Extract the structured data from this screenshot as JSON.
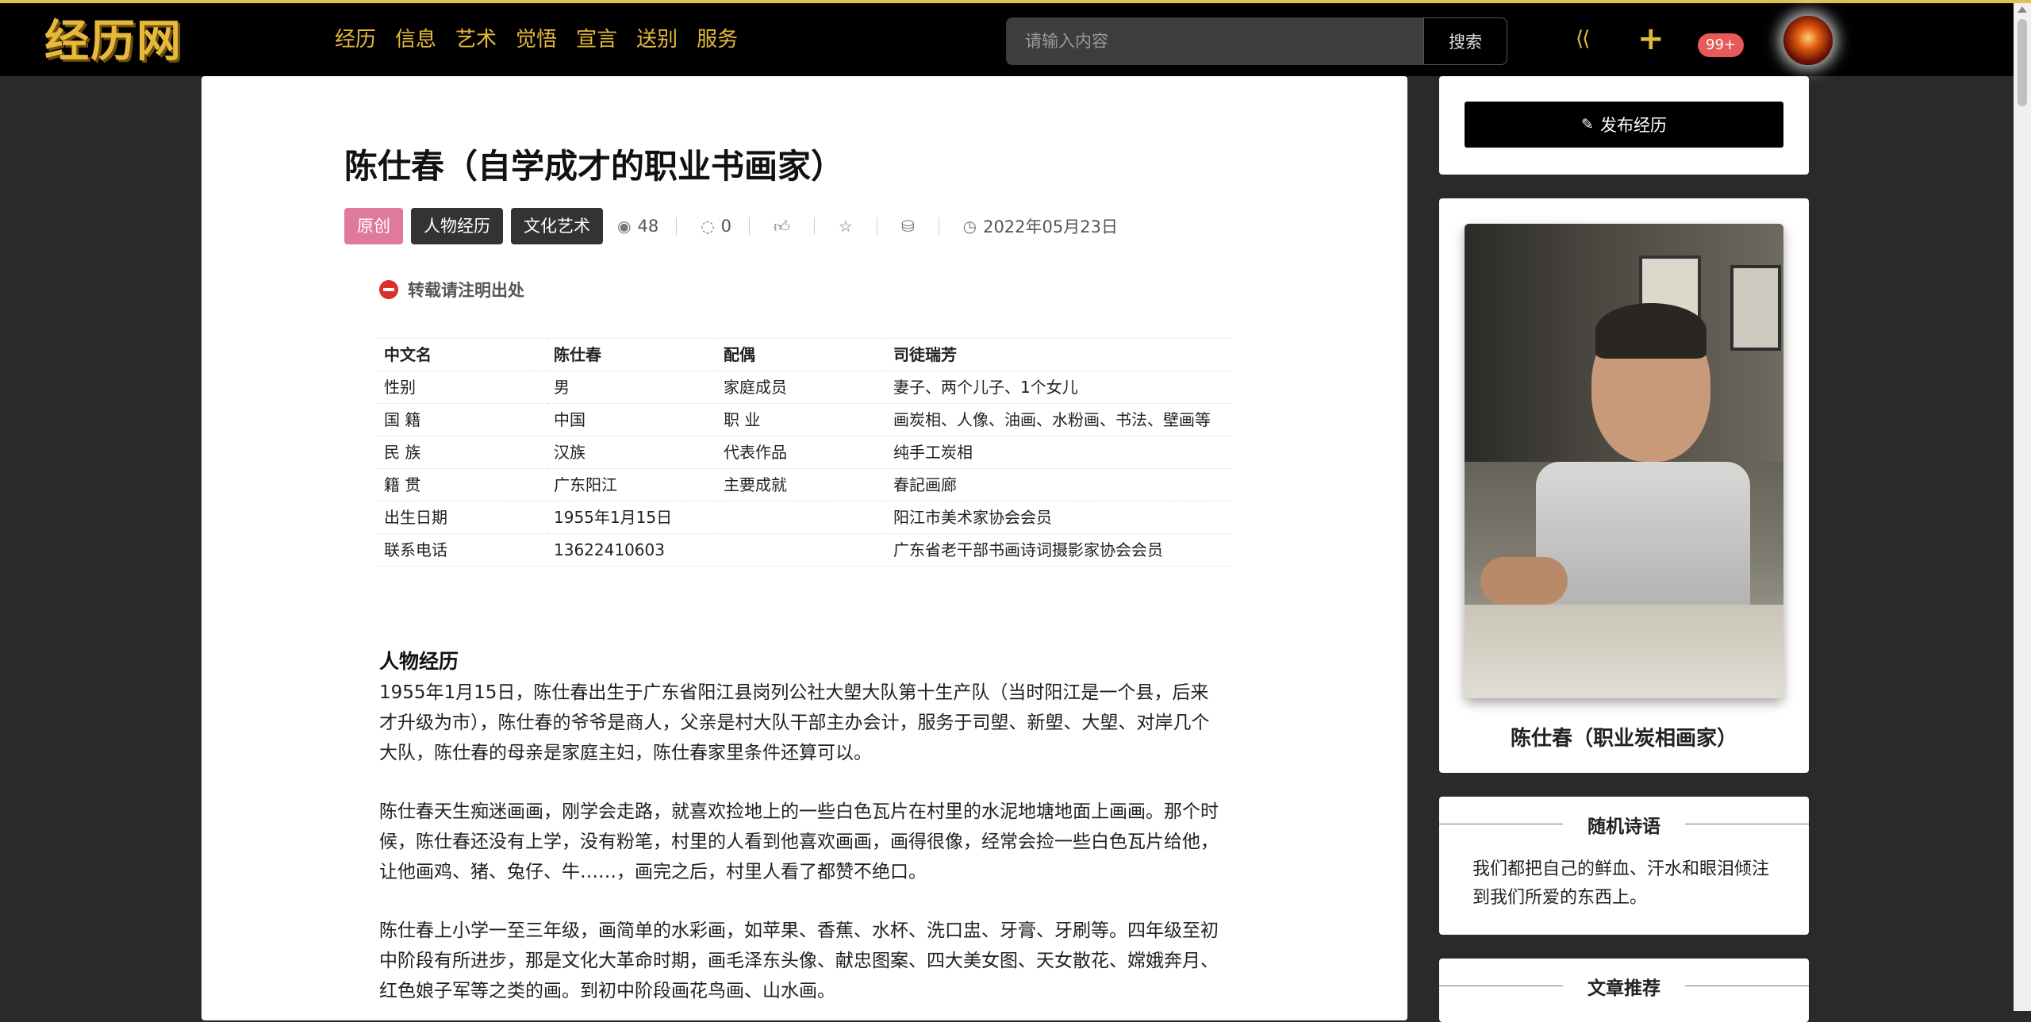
{
  "header": {
    "logo": "经历网",
    "nav": [
      "经历",
      "信息",
      "艺术",
      "觉悟",
      "宣言",
      "送别",
      "服务"
    ],
    "search_placeholder": "请输入内容",
    "search_button": "搜索",
    "notification_count": "99+"
  },
  "article": {
    "title": "陈仕春（自学成才的职业书画家）",
    "tags": [
      "原创",
      "人物经历",
      "文化艺术"
    ],
    "views": "48",
    "comments": "0",
    "date": "2022年05月23日",
    "notice": "转载请注明出处",
    "info_rows": [
      [
        "中文名",
        "陈仕春",
        "配偶",
        "司徒瑞芳"
      ],
      [
        "性别",
        "男",
        "家庭成员",
        "妻子、两个儿子、1个女儿"
      ],
      [
        "国 籍",
        "中国",
        "职 业",
        "画炭相、人像、油画、水粉画、书法、壁画等"
      ],
      [
        "民 族",
        "汉族",
        "代表作品",
        "纯手工炭相"
      ],
      [
        "籍 贯",
        "广东阳江",
        "主要成就",
        "春記画廊"
      ],
      [
        "出生日期",
        "1955年1月15日",
        "",
        "阳江市美术家协会会员"
      ],
      [
        "联系电话",
        "13622410603",
        "",
        "广东省老干部书画诗词摄影家协会会员"
      ]
    ],
    "section_title": "人物经历",
    "paragraphs": [
      "1955年1月15日，陈仕春出生于广东省阳江县岗列公社大塱大队第十生产队（当时阳江是一个县，后来才升级为市），陈仕春的爷爷是商人，父亲是村大队干部主办会计，服务于司塱、新塱、大塱、对岸几个大队，陈仕春的母亲是家庭主妇，陈仕春家里条件还算可以。",
      "陈仕春天生痴迷画画，刚学会走路，就喜欢捡地上的一些白色瓦片在村里的水泥地塘地面上画画。那个时候，陈仕春还没有上学，没有粉笔，村里的人看到他喜欢画画，画得很像，经常会捡一些白色瓦片给他，让他画鸡、猪、兔仔、牛……，画完之后，村里人看了都赞不绝口。",
      "陈仕春上小学一至三年级，画简单的水彩画，如苹果、香蕉、水杯、洗口盅、牙膏、牙刷等。四年级至初中阶段有所进步，那是文化大革命时期，画毛泽东头像、献忠图案、四大美女图、天女散花、嫦娥奔月、红色娘子军等之类的画。到初中阶段画花鸟画、山水画。"
    ]
  },
  "sidebar": {
    "publish_button": "发布经历",
    "photo_caption": "陈仕春（职业炭相画家）",
    "poem_title": "随机诗语",
    "poem_text": "我们都把自己的鲜血、汗水和眼泪倾注到我们所爱的东西上。",
    "recommend_title": "文章推荐"
  }
}
